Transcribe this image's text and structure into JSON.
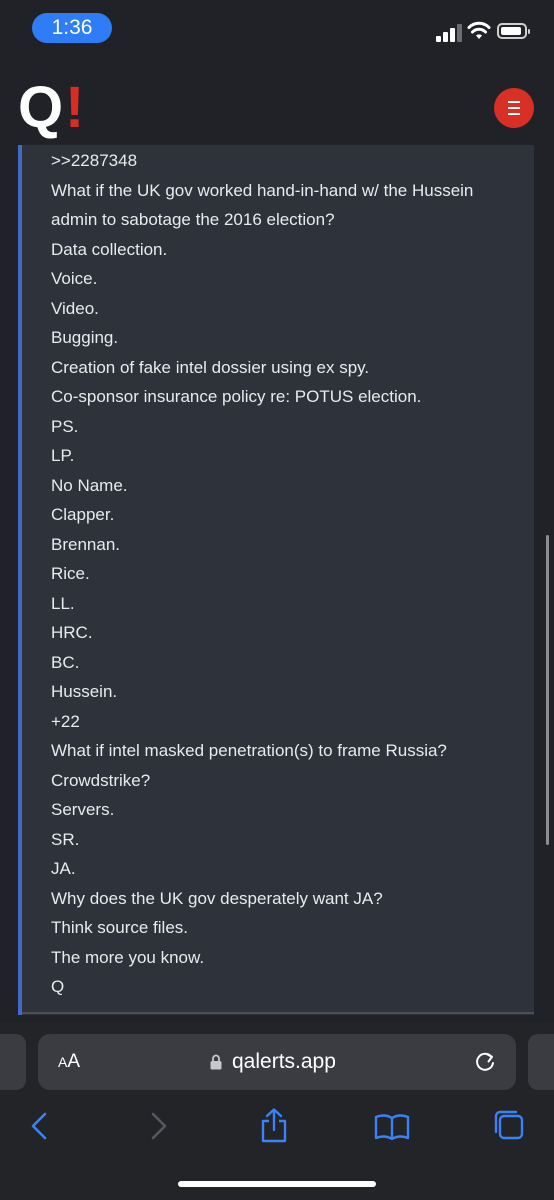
{
  "status_bar": {
    "time": "1:36"
  },
  "header": {
    "logo_q": "Q",
    "logo_bang": "!"
  },
  "post": {
    "lines": [
      ">>2287348",
      "What if the UK gov worked hand-in-hand w/ the Hussein",
      "admin to sabotage the 2016 election?",
      "Data collection.",
      "Voice.",
      "Video.",
      "Bugging.",
      "Creation of fake intel dossier using ex spy.",
      "Co-sponsor insurance policy re: POTUS election.",
      "PS.",
      "LP.",
      "No Name.",
      "Clapper.",
      "Brennan.",
      "Rice.",
      "LL.",
      "HRC.",
      "BC.",
      "Hussein.",
      "+22",
      "What if intel masked penetration(s) to frame Russia?",
      "Crowdstrike?",
      "Servers.",
      "SR.",
      "JA.",
      "Why does the UK gov desperately want JA?",
      "Think source files.",
      "The more you know.",
      "Q"
    ]
  },
  "browser": {
    "aa_label_small": "A",
    "aa_label_large": "A",
    "url": "qalerts.app"
  },
  "colors": {
    "accent_red": "#d93025",
    "quote_bar_blue": "#4468c8",
    "ios_blue": "#2f7df6"
  }
}
